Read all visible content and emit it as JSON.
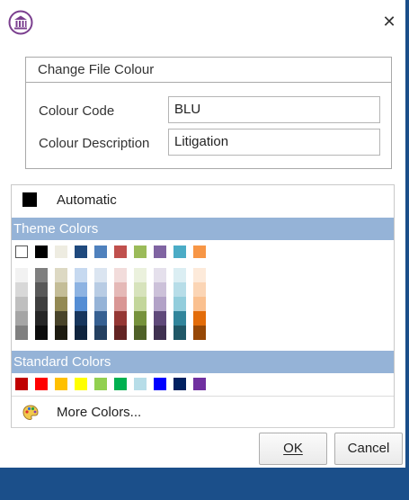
{
  "dialog": {
    "close_label": "✕",
    "icon": "bank-building-icon"
  },
  "group": {
    "title": "Change File Colour",
    "colour_code_label": "Colour Code",
    "colour_code_value": "BLU",
    "colour_description_label": "Colour Description",
    "colour_description_value": "Litigation"
  },
  "picker": {
    "automatic_label": "Automatic",
    "theme_header": "Theme Colors",
    "standard_header": "Standard Colors",
    "more_colors_label": "More Colors...",
    "theme_top": [
      "#ffffff",
      "#000000",
      "#eeece1",
      "#1f497d",
      "#4f81bd",
      "#c0504d",
      "#9bbb59",
      "#8064a2",
      "#4bacc6",
      "#f79646"
    ],
    "theme_shades": [
      [
        "#f2f2f2",
        "#d8d8d8",
        "#bfbfbf",
        "#a5a5a5",
        "#7f7f7f"
      ],
      [
        "#7f7f7f",
        "#595959",
        "#3f3f3f",
        "#262626",
        "#0c0c0c"
      ],
      [
        "#ddd9c3",
        "#c4bd97",
        "#938953",
        "#494429",
        "#1d1b10"
      ],
      [
        "#c6d9f0",
        "#8db3e2",
        "#548dd4",
        "#17365d",
        "#0f243e"
      ],
      [
        "#dbe5f1",
        "#b8cce4",
        "#95b3d7",
        "#366092",
        "#244061"
      ],
      [
        "#f2dcdb",
        "#e5b9b7",
        "#d99694",
        "#953734",
        "#632423"
      ],
      [
        "#ebf1dd",
        "#d7e3bc",
        "#c3d69b",
        "#76923c",
        "#4f6128"
      ],
      [
        "#e5e0ec",
        "#ccc1d9",
        "#b2a2c7",
        "#5f497a",
        "#3f3151"
      ],
      [
        "#dbeef3",
        "#b7dde8",
        "#92cddc",
        "#31859b",
        "#205867"
      ],
      [
        "#fdeada",
        "#fbd5b5",
        "#fac08f",
        "#e36c09",
        "#974806"
      ]
    ],
    "standard": [
      "#c00000",
      "#ff0000",
      "#ffc000",
      "#ffff00",
      "#92d050",
      "#00b050",
      "#b7dde8",
      "#0000ff",
      "#002060",
      "#7030a0"
    ]
  },
  "buttons": {
    "ok_label": "OK",
    "cancel_label": "Cancel"
  }
}
